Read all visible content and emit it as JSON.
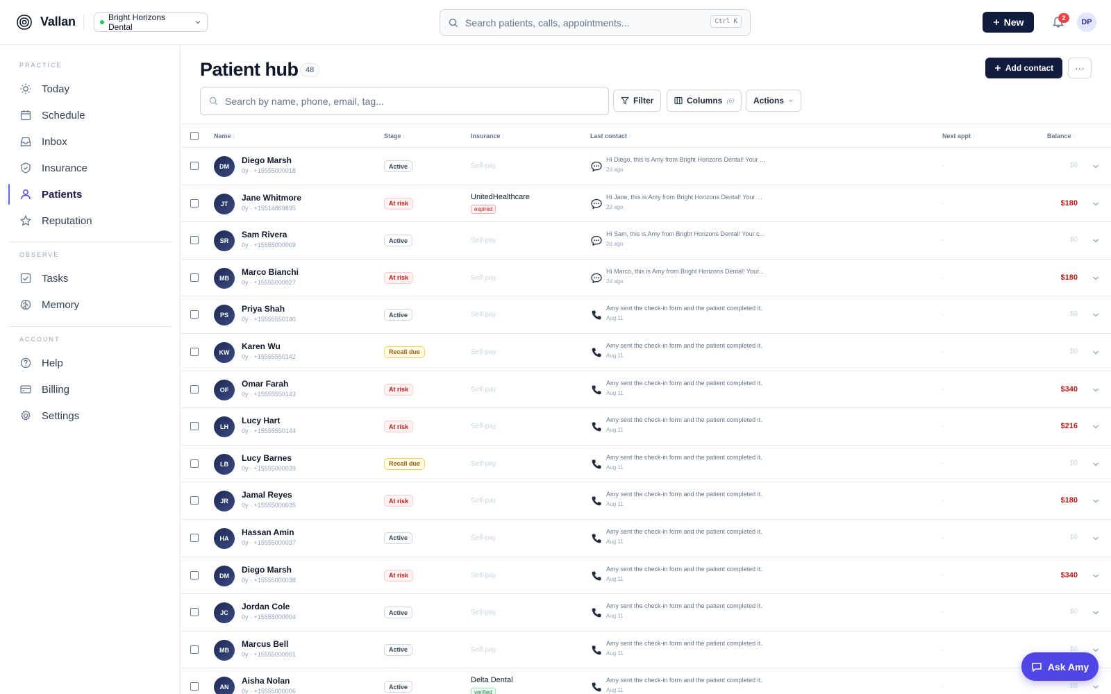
{
  "app": {
    "brand": "Vallan",
    "practice": "Bright Horizons Dental"
  },
  "header": {
    "search_placeholder": "Search patients, calls, appointments...",
    "shortcut": "Ctrl K",
    "new_label": "New",
    "notifications_count": "2",
    "user_initials": "DP"
  },
  "sidebar": {
    "sections": [
      {
        "title": "Practice",
        "items": [
          "Today",
          "Schedule",
          "Inbox",
          "Insurance",
          "Patients",
          "Reputation"
        ]
      },
      {
        "title": "Observe",
        "items": [
          "Tasks",
          "Memory"
        ]
      },
      {
        "title": "Account",
        "items": [
          "Help",
          "Billing",
          "Settings"
        ]
      }
    ],
    "active": "Patients"
  },
  "page": {
    "title": "Patient hub",
    "count": "48",
    "add_contact_label": "Add contact",
    "more_label": "···",
    "search_placeholder": "Search by name, phone, email, tag...",
    "filter_label": "Filter",
    "columns_label": "Columns",
    "columns_count": "(6)",
    "actions_label": "Actions"
  },
  "table": {
    "headers": [
      "Name",
      "Stage",
      "Insurance",
      "Last contact",
      "Next appt",
      "Balance"
    ],
    "rows": [
      {
        "initials": "DM",
        "name": "Diego Marsh",
        "meta": "0y · +15555000018",
        "stage": "Active",
        "insurance": "Self-pay",
        "ins_tag": "",
        "contact_type": "sms",
        "contact_text": "Hi Diego, this is Amy from Bright Horizons Dental! Your ...",
        "contact_date": "2d ago",
        "next": "-",
        "balance": "$0"
      },
      {
        "initials": "JT",
        "name": "Jane Whitmore",
        "meta": "0y · +15514869895",
        "stage": "At risk",
        "insurance": "UnitedHealthcare",
        "ins_tag": "expired",
        "contact_type": "sms",
        "contact_text": "Hi Jane, this is Amy from Bright Horizons Dental! Your ...",
        "contact_date": "2d ago",
        "next": "-",
        "balance": "$180"
      },
      {
        "initials": "SR",
        "name": "Sam Rivera",
        "meta": "0y · +15555000009",
        "stage": "Active",
        "insurance": "Self-pay",
        "ins_tag": "",
        "contact_type": "sms",
        "contact_text": "Hi Sam, this is Amy from Bright Horizons Dental! Your c...",
        "contact_date": "2d ago",
        "next": "-",
        "balance": "$0"
      },
      {
        "initials": "MB",
        "name": "Marco Bianchi",
        "meta": "0y · +15555000027",
        "stage": "At risk",
        "insurance": "Self-pay",
        "ins_tag": "",
        "contact_type": "sms",
        "contact_text": "Hi Marco, this is Amy from Bright Horizons Dental! Your...",
        "contact_date": "2d ago",
        "next": "-",
        "balance": "$180"
      },
      {
        "initials": "PS",
        "name": "Priya Shah",
        "meta": "0y · +15555550140",
        "stage": "Active",
        "insurance": "Self-pay",
        "ins_tag": "",
        "contact_type": "call",
        "contact_text": "Amy sent the check-in form and the patient completed it.",
        "contact_date": "Aug 11",
        "next": "-",
        "balance": "$0"
      },
      {
        "initials": "KW",
        "name": "Karen Wu",
        "meta": "0y · +15555550142",
        "stage": "Recall due",
        "insurance": "Self-pay",
        "ins_tag": "",
        "contact_type": "call",
        "contact_text": "Amy sent the check-in form and the patient completed it.",
        "contact_date": "Aug 11",
        "next": "-",
        "balance": "$0"
      },
      {
        "initials": "OF",
        "name": "Omar Farah",
        "meta": "0y · +15555550143",
        "stage": "At risk",
        "insurance": "Self-pay",
        "ins_tag": "",
        "contact_type": "call",
        "contact_text": "Amy sent the check-in form and the patient completed it.",
        "contact_date": "Aug 11",
        "next": "-",
        "balance": "$340"
      },
      {
        "initials": "LH",
        "name": "Lucy Hart",
        "meta": "0y · +15555550144",
        "stage": "At risk",
        "insurance": "Self-pay",
        "ins_tag": "",
        "contact_type": "call",
        "contact_text": "Amy sent the check-in form and the patient completed it.",
        "contact_date": "Aug 11",
        "next": "-",
        "balance": "$216"
      },
      {
        "initials": "LB",
        "name": "Lucy Barnes",
        "meta": "0y · +15555000039",
        "stage": "Recall due",
        "insurance": "Self-pay",
        "ins_tag": "",
        "contact_type": "call",
        "contact_text": "Amy sent the check-in form and the patient completed it.",
        "contact_date": "Aug 11",
        "next": "-",
        "balance": "$0"
      },
      {
        "initials": "JR",
        "name": "Jamal Reyes",
        "meta": "0y · +15555000035",
        "stage": "At risk",
        "insurance": "Self-pay",
        "ins_tag": "",
        "contact_type": "call",
        "contact_text": "Amy sent the check-in form and the patient completed it.",
        "contact_date": "Aug 11",
        "next": "-",
        "balance": "$180"
      },
      {
        "initials": "HA",
        "name": "Hassan Amin",
        "meta": "0y · +15555000037",
        "stage": "Active",
        "insurance": "Self-pay",
        "ins_tag": "",
        "contact_type": "call",
        "contact_text": "Amy sent the check-in form and the patient completed it.",
        "contact_date": "Aug 11",
        "next": "-",
        "balance": "$0"
      },
      {
        "initials": "DM",
        "name": "Diego Marsh",
        "meta": "0y · +15555000038",
        "stage": "At risk",
        "insurance": "Self-pay",
        "ins_tag": "",
        "contact_type": "call",
        "contact_text": "Amy sent the check-in form and the patient completed it.",
        "contact_date": "Aug 11",
        "next": "-",
        "balance": "$340"
      },
      {
        "initials": "JC",
        "name": "Jordan Cole",
        "meta": "0y · +15555000004",
        "stage": "Active",
        "insurance": "Self-pay",
        "ins_tag": "",
        "contact_type": "call",
        "contact_text": "Amy sent the check-in form and the patient completed it.",
        "contact_date": "Aug 11",
        "next": "-",
        "balance": "$0"
      },
      {
        "initials": "MB",
        "name": "Marcus Bell",
        "meta": "0y · +15555000001",
        "stage": "Active",
        "insurance": "Self-pay",
        "ins_tag": "",
        "contact_type": "call",
        "contact_text": "Amy sent the check-in form and the patient completed it.",
        "contact_date": "Aug 11",
        "next": "-",
        "balance": "$0"
      },
      {
        "initials": "AN",
        "name": "Aisha Nolan",
        "meta": "0y · +15555000006",
        "stage": "Active",
        "insurance": "Delta Dental",
        "ins_tag": "verified",
        "contact_type": "call",
        "contact_text": "Amy sent the check-in form and the patient completed it.",
        "contact_date": "Aug 11",
        "next": "-",
        "balance": "$0"
      }
    ]
  },
  "ask_amy_label": "Ask Amy",
  "colors": {
    "primary": "#111d3f",
    "accent": "#4f46e5",
    "danger": "#b91c1c",
    "warning": "#a16207",
    "success": "#22c55e"
  }
}
